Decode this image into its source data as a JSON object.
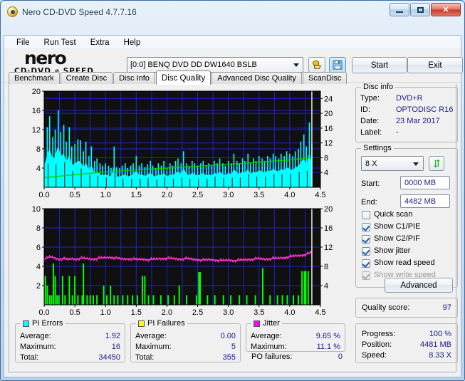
{
  "window": {
    "title": "Nero CD-DVD Speed 4.7.7.16",
    "icon": "nero-disc-icon",
    "minimize": "minimize-icon",
    "maximize": "maximize-icon",
    "close": "✕"
  },
  "menu": [
    "File",
    "Run Test",
    "Extra",
    "Help"
  ],
  "toolbar": {
    "logo_line1": "nero",
    "logo_line2": "CD·DVD ⌀ SPEED",
    "drive": "[0:0]   BENQ DVD DD DW1640 BSLB",
    "drive_arrow": "chevron-down-icon",
    "eject_icon": "hand-disc-icon",
    "save_icon": "floppy-save-icon",
    "start_label": "Start",
    "exit_label": "Exit"
  },
  "tabs": [
    {
      "label": "Benchmark",
      "active": false
    },
    {
      "label": "Create Disc",
      "active": false
    },
    {
      "label": "Disc Info",
      "active": false
    },
    {
      "label": "Disc Quality",
      "active": true
    },
    {
      "label": "Advanced Disc Quality",
      "active": false
    },
    {
      "label": "ScanDisc",
      "active": false
    }
  ],
  "disc_info": {
    "title": "Disc info",
    "rows": [
      {
        "label": "Type:",
        "value": "DVD+R"
      },
      {
        "label": "ID:",
        "value": "OPTODISC R16"
      },
      {
        "label": "Date:",
        "value": "23 Mar 2017"
      },
      {
        "label": "Label:",
        "value": "-"
      }
    ]
  },
  "settings": {
    "title": "Settings",
    "speed": "8 X",
    "speed_arrow": "chevron-down-icon",
    "refresh_icon": "refresh-arrows-icon",
    "start_label": "Start:",
    "start_value": "0000 MB",
    "end_label": "End:",
    "end_value": "4482 MB",
    "checkboxes": [
      {
        "label": "Quick scan",
        "checked": false,
        "enabled": true
      },
      {
        "label": "Show C1/PIE",
        "checked": true,
        "enabled": true
      },
      {
        "label": "Show C2/PIF",
        "checked": true,
        "enabled": true
      },
      {
        "label": "Show jitter",
        "checked": true,
        "enabled": true
      },
      {
        "label": "Show read speed",
        "checked": true,
        "enabled": true
      },
      {
        "label": "Show write speed",
        "checked": true,
        "enabled": false
      }
    ],
    "advanced_label": "Advanced"
  },
  "quality": {
    "label": "Quality score:",
    "value": "97"
  },
  "progress": {
    "rows": [
      {
        "label": "Progress:",
        "value": "100 %"
      },
      {
        "label": "Position:",
        "value": "4481 MB"
      },
      {
        "label": "Speed:",
        "value": "8.33 X"
      }
    ]
  },
  "stats": {
    "pi_errors": {
      "title": "PI Errors",
      "color": "#00ffff",
      "rows": [
        {
          "label": "Average:",
          "value": "1.92"
        },
        {
          "label": "Maximum:",
          "value": "16"
        },
        {
          "label": "Total:",
          "value": "34450"
        }
      ]
    },
    "pi_failures": {
      "title": "PI Failures",
      "color": "#ffff00",
      "rows": [
        {
          "label": "Average:",
          "value": "0.00"
        },
        {
          "label": "Maximum:",
          "value": "5"
        },
        {
          "label": "Total:",
          "value": "355"
        }
      ]
    },
    "jitter": {
      "title": "Jitter",
      "color": "#ff00ff",
      "rows": [
        {
          "label": "Average:",
          "value": "9.65 %"
        },
        {
          "label": "Maximum:",
          "value": "11.1 %"
        }
      ],
      "po_label": "PO failures:",
      "po_value": "0"
    }
  },
  "chart_data": [
    {
      "type": "area",
      "name": "pi-errors-chart",
      "title": "PI Errors / read speed",
      "xlabel": "",
      "ylabel": "",
      "x_ticks": [
        "0.0",
        "0.5",
        "1.0",
        "1.5",
        "2.0",
        "2.5",
        "3.0",
        "3.5",
        "4.0",
        "4.5"
      ],
      "xlim": [
        0.0,
        4.5
      ],
      "y_left_ticks": [
        4,
        8,
        12,
        16,
        20
      ],
      "ylim_left": [
        0,
        20
      ],
      "y_right_ticks": [
        4,
        8,
        12,
        16,
        20,
        24
      ],
      "ylim_right": [
        0,
        26
      ],
      "grid": true,
      "bg": "#101010",
      "series": [
        {
          "name": "PI Errors",
          "color": "#00ffff",
          "kind": "area",
          "x": [
            0.0,
            0.05,
            0.09,
            0.14,
            0.18,
            0.23,
            0.27,
            0.32,
            0.36,
            0.41,
            0.45,
            0.5,
            0.55,
            0.59,
            0.64,
            0.68,
            0.73,
            0.77,
            0.82,
            0.86,
            0.91,
            0.95,
            1.0,
            1.05,
            1.09,
            1.14,
            1.18,
            1.23,
            1.27,
            1.32,
            1.36,
            1.41,
            1.45,
            1.5,
            1.55,
            1.59,
            1.64,
            1.68,
            1.73,
            1.77,
            1.82,
            1.86,
            1.91,
            1.95,
            2.0,
            2.05,
            2.09,
            2.14,
            2.18,
            2.23,
            2.27,
            2.32,
            2.36,
            2.41,
            2.45,
            2.5,
            2.55,
            2.59,
            2.64,
            2.68,
            2.73,
            2.77,
            2.82,
            2.86,
            2.91,
            2.95,
            3.0,
            3.05,
            3.09,
            3.14,
            3.18,
            3.23,
            3.27,
            3.32,
            3.36,
            3.41,
            3.45,
            3.5,
            3.55,
            3.59,
            3.64,
            3.68,
            3.73,
            3.77,
            3.82,
            3.86,
            3.91,
            3.95,
            4.0,
            4.05,
            4.09,
            4.14,
            4.18,
            4.23,
            4.27,
            4.32,
            4.36
          ],
          "y": [
            8.0,
            12.5,
            14.8,
            10.5,
            12.0,
            16.0,
            11.5,
            13.0,
            9.5,
            12.5,
            8.5,
            9.0,
            10.0,
            9.8,
            7.5,
            9.5,
            6.5,
            8.5,
            5.5,
            6.0,
            5.0,
            4.5,
            5.0,
            4.5,
            4.0,
            8.5,
            4.2,
            4.0,
            4.5,
            5.0,
            4.0,
            4.5,
            5.0,
            6.5,
            4.5,
            5.0,
            4.2,
            4.8,
            5.5,
            4.5,
            4.0,
            5.0,
            4.5,
            5.5,
            4.0,
            5.0,
            4.5,
            5.5,
            6.0,
            5.0,
            7.5,
            5.0,
            4.5,
            5.5,
            5.0,
            4.5,
            5.0,
            5.5,
            4.5,
            5.0,
            4.5,
            5.5,
            5.0,
            6.0,
            5.0,
            4.5,
            5.5,
            5.0,
            7.0,
            5.5,
            5.0,
            6.0,
            5.5,
            7.0,
            5.0,
            6.0,
            5.5,
            6.5,
            6.0,
            5.5,
            6.5,
            6.0,
            7.0,
            6.5,
            6.0,
            7.0,
            6.5,
            7.5,
            7.0,
            6.5,
            7.5,
            8.0,
            9.5,
            11.0,
            8.5,
            13.5,
            9.0
          ]
        },
        {
          "name": "Read speed",
          "color": "#00d000",
          "kind": "line",
          "axis": "right",
          "x": [
            0.0,
            0.5,
            1.0,
            1.5,
            2.0,
            2.5,
            3.0,
            3.5,
            4.0,
            4.36
          ],
          "y": [
            2.6,
            3.4,
            4.2,
            4.7,
            5.2,
            5.7,
            6.2,
            6.8,
            7.4,
            8.0
          ]
        }
      ],
      "cursor_x": 4.36
    },
    {
      "type": "bar",
      "name": "pi-failures-chart",
      "title": "PI Failures / jitter",
      "x_ticks": [
        "0.0",
        "0.5",
        "1.0",
        "1.5",
        "2.0",
        "2.5",
        "3.0",
        "3.5",
        "4.0",
        "4.5"
      ],
      "xlim": [
        0.0,
        4.5
      ],
      "y_left_ticks": [
        2,
        4,
        6,
        8,
        10
      ],
      "ylim_left": [
        0,
        10
      ],
      "y_right_ticks": [
        4,
        8,
        12,
        16,
        20
      ],
      "ylim_right": [
        0,
        20
      ],
      "grid": true,
      "bg": "#101010",
      "series": [
        {
          "name": "PI Failures",
          "color": "#00ff00",
          "kind": "bar",
          "x": [
            0.02,
            0.05,
            0.09,
            0.12,
            0.15,
            0.18,
            0.21,
            0.24,
            0.3,
            0.34,
            0.41,
            0.46,
            0.5,
            0.55,
            0.62,
            0.64,
            0.7,
            0.75,
            0.8,
            0.86,
            0.97,
            1.02,
            1.08,
            1.14,
            1.2,
            1.28,
            1.36,
            1.44,
            1.52,
            1.6,
            1.64,
            1.7,
            1.78,
            1.9,
            2.02,
            2.12,
            2.2,
            2.32,
            2.48,
            2.52,
            2.54,
            2.66,
            2.78,
            2.92,
            3.04,
            3.18,
            3.3,
            3.44,
            3.56,
            3.68,
            3.8,
            3.88,
            3.96,
            4.06,
            4.14,
            4.2,
            4.24,
            4.26,
            4.3
          ],
          "y": [
            3,
            2,
            1,
            1,
            4.3,
            3,
            1,
            1,
            3,
            1,
            3,
            1,
            3,
            1,
            1,
            4.3,
            1,
            1,
            1,
            1,
            2,
            1,
            2,
            1,
            1,
            1,
            1,
            1,
            1,
            3,
            3,
            1,
            1,
            1,
            1,
            1,
            2,
            1,
            1,
            3.4,
            3.4,
            1,
            1,
            1,
            1,
            1,
            1,
            1,
            3.8,
            1,
            1,
            1,
            1,
            1,
            1,
            3.5,
            3.5,
            3.5,
            3.5
          ]
        },
        {
          "name": "Jitter",
          "color": "#ff30d0",
          "kind": "line",
          "axis": "right",
          "x": [
            0.0,
            0.05,
            0.1,
            0.15,
            0.2,
            0.25,
            0.3,
            0.35,
            0.4,
            0.45,
            0.5,
            0.6,
            0.7,
            0.8,
            0.9,
            1.0,
            1.1,
            1.2,
            1.3,
            1.4,
            1.5,
            1.6,
            1.7,
            1.8,
            1.9,
            2.0,
            2.1,
            2.2,
            2.3,
            2.4,
            2.5,
            2.6,
            2.7,
            2.8,
            2.9,
            3.0,
            3.1,
            3.2,
            3.3,
            3.4,
            3.5,
            3.6,
            3.7,
            3.8,
            3.9,
            4.0,
            4.1,
            4.2,
            4.3,
            4.36
          ],
          "y": [
            9.6,
            9.7,
            10.0,
            9.8,
            9.6,
            9.5,
            9.6,
            9.5,
            9.4,
            9.6,
            9.5,
            9.7,
            9.6,
            9.5,
            9.7,
            9.8,
            9.9,
            9.6,
            9.5,
            9.6,
            9.4,
            9.5,
            9.4,
            9.5,
            9.6,
            9.7,
            9.6,
            9.5,
            9.6,
            9.5,
            9.4,
            9.3,
            9.4,
            9.3,
            9.2,
            9.3,
            9.2,
            9.3,
            9.4,
            9.5,
            9.6,
            9.5,
            9.6,
            9.7,
            9.8,
            10.0,
            10.2,
            10.3,
            10.6,
            11.0
          ]
        }
      ],
      "cursor_x": 4.36
    }
  ]
}
